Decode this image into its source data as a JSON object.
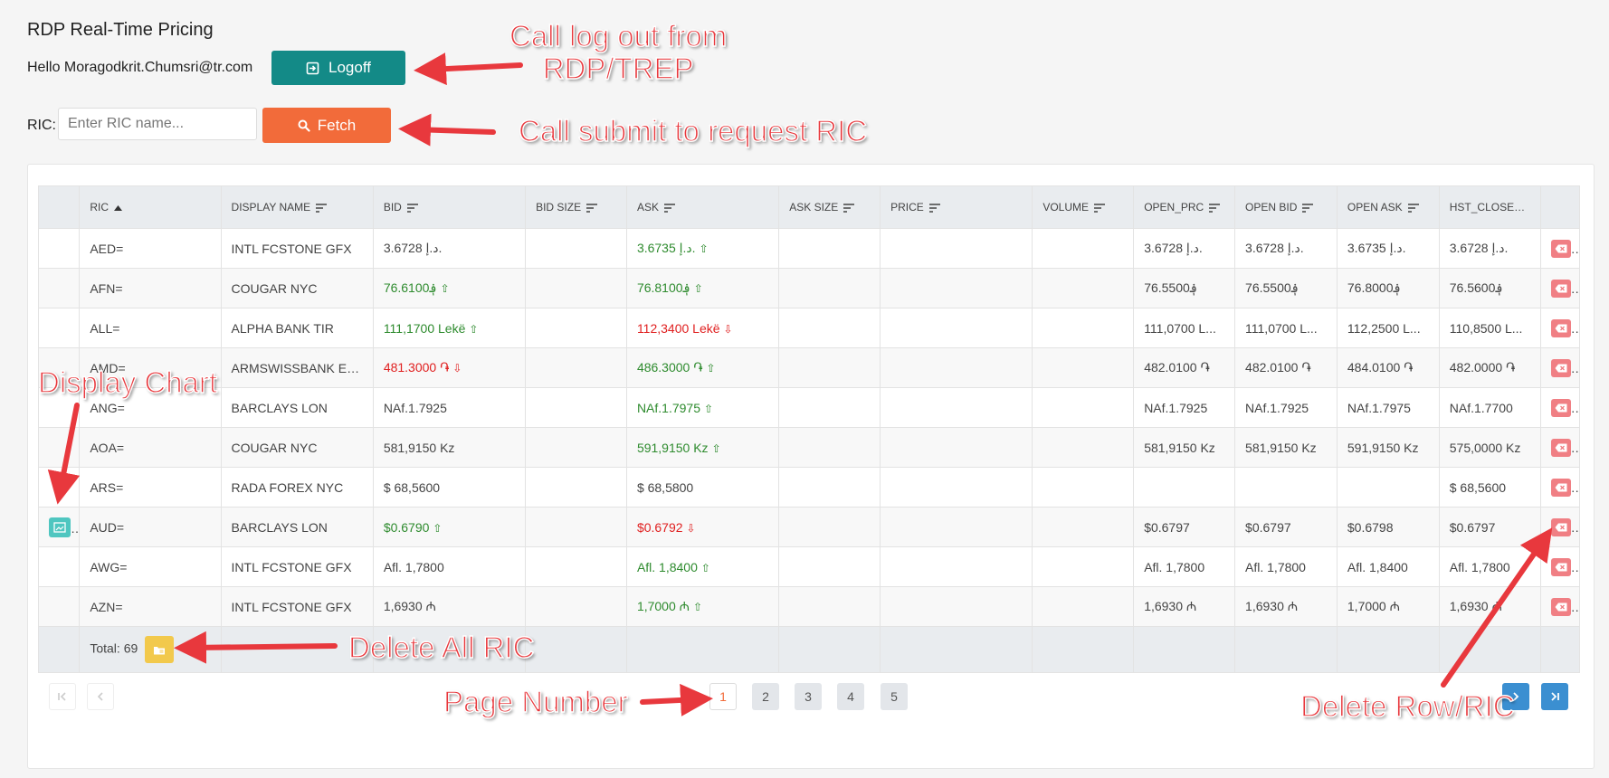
{
  "app_title": "RDP Real-Time Pricing",
  "greeting": "Hello Moragodkrit.Chumsri@tr.com",
  "logoff_label": "Logoff",
  "ric_label": "RIC:",
  "ric_input": {
    "value": "",
    "placeholder": "Enter RIC name..."
  },
  "fetch_label": "Fetch",
  "table": {
    "columns": [
      "RIC",
      "DISPLAY NAME",
      "BID",
      "BID SIZE",
      "ASK",
      "ASK SIZE",
      "PRICE",
      "VOLUME",
      "OPEN_PRC",
      "OPEN BID",
      "OPEN ASK",
      "HST_CLOSE"
    ],
    "sorted_column": "RIC",
    "rows": [
      {
        "ric": "AED=",
        "name": "INTL FCSTONE GFX",
        "bid": "3.6728 د.إ.",
        "bid_dir": "",
        "ask": "3.6735 د.إ.",
        "ask_dir": "up",
        "open_prc": "3.6728 د.إ.",
        "open_bid": "3.6728 د.إ.",
        "open_ask": "3.6735 د.إ.",
        "hst_close": "3.6728 د.إ."
      },
      {
        "ric": "AFN=",
        "name": "COUGAR NYC",
        "bid": "76.6100؋",
        "bid_dir": "up",
        "ask": "76.8100؋",
        "ask_dir": "up",
        "open_prc": "76.5500؋",
        "open_bid": "76.5500؋",
        "open_ask": "76.8000؋",
        "hst_close": "76.5600؋"
      },
      {
        "ric": "ALL=",
        "name": "ALPHA BANK TIR",
        "bid": "111,1700 Lekë",
        "bid_dir": "up",
        "ask": "112,3400 Lekë",
        "ask_dir": "down",
        "open_prc": "111,0700 L...",
        "open_bid": "111,0700 L...",
        "open_ask": "112,2500 L...",
        "hst_close": "110,8500 L..."
      },
      {
        "ric": "AMD=",
        "name": "ARMSWISSBANK EVN",
        "bid": "481.3000 ֏",
        "bid_dir": "down",
        "ask": "486.3000 ֏",
        "ask_dir": "up",
        "open_prc": "482.0100 ֏",
        "open_bid": "482.0100 ֏",
        "open_ask": "484.0100 ֏",
        "hst_close": "482.0000 ֏"
      },
      {
        "ric": "ANG=",
        "name": "BARCLAYS LON",
        "bid": "NAf.1.7925",
        "bid_dir": "",
        "ask": "NAf.1.7975",
        "ask_dir": "up",
        "open_prc": "NAf.1.7925",
        "open_bid": "NAf.1.7925",
        "open_ask": "NAf.1.7975",
        "hst_close": "NAf.1.7700"
      },
      {
        "ric": "AOA=",
        "name": "COUGAR NYC",
        "bid": "581,9150 Kz",
        "bid_dir": "",
        "ask": "591,9150 Kz",
        "ask_dir": "up",
        "open_prc": "581,9150 Kz",
        "open_bid": "581,9150 Kz",
        "open_ask": "591,9150 Kz",
        "hst_close": "575,0000 Kz"
      },
      {
        "ric": "ARS=",
        "name": "RADA FOREX NYC",
        "bid": "$ 68,5600",
        "bid_dir": "",
        "ask": "$ 68,5800",
        "ask_dir": "",
        "open_prc": "",
        "open_bid": "",
        "open_ask": "",
        "hst_close": "$ 68,5600"
      },
      {
        "ric": "AUD=",
        "name": "BARCLAYS LON",
        "bid": "$0.6790",
        "bid_dir": "up",
        "ask": "$0.6792",
        "ask_dir": "down",
        "open_prc": "$0.6797",
        "open_bid": "$0.6797",
        "open_ask": "$0.6798",
        "hst_close": "$0.6797",
        "chart": true
      },
      {
        "ric": "AWG=",
        "name": "INTL FCSTONE GFX",
        "bid": "Afl. 1,7800",
        "bid_dir": "",
        "ask": "Afl. 1,8400",
        "ask_dir": "up",
        "open_prc": "Afl. 1,7800",
        "open_bid": "Afl. 1,7800",
        "open_ask": "Afl. 1,8400",
        "hst_close": "Afl. 1,7800"
      },
      {
        "ric": "AZN=",
        "name": "INTL FCSTONE GFX",
        "bid": "1,6930 ₼",
        "bid_dir": "",
        "ask": "1,7000 ₼",
        "ask_dir": "up",
        "open_prc": "1,6930 ₼",
        "open_bid": "1,6930 ₼",
        "open_ask": "1,7000 ₼",
        "hst_close": "1,6930 ₼"
      }
    ],
    "total_label": "Total: 69"
  },
  "pagination": {
    "pages": [
      "1",
      "2",
      "3",
      "4",
      "5"
    ],
    "current": "1"
  },
  "annotations": {
    "logout": "Call log out from\nRDP/TREP",
    "submit": "Call submit to request RIC",
    "chart": "Display Chart",
    "delete_all": "Delete All RIC",
    "page_number": "Page Number",
    "delete_row": "Delete Row/RIC"
  },
  "colors": {
    "logoff": "#138a87",
    "fetch": "#f26b3a",
    "up": "#2e8b2e",
    "down": "#e02020",
    "delete": "#f07f84",
    "chart": "#4fc6c0",
    "delete_all": "#f2c94c",
    "annotation": "#e8383d",
    "pager_nav": "#3b8fd1"
  }
}
